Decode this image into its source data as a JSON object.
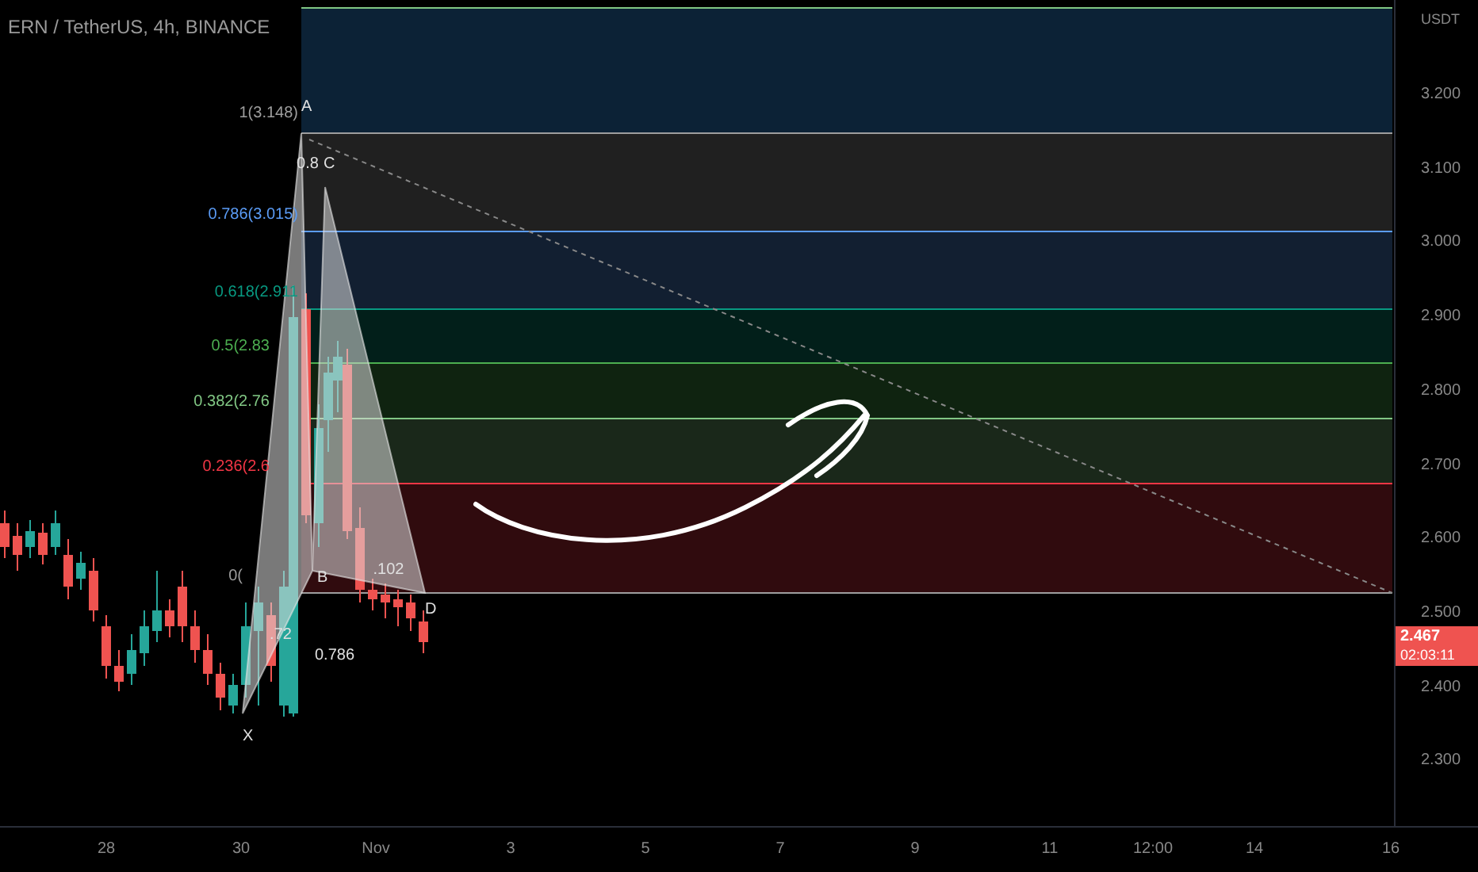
{
  "title": "ERN / TetherUS, 4h, BINANCE",
  "fib_levels": [
    {
      "label": "1(3.148)",
      "color": "#9e9e9e"
    },
    {
      "label": "0.786(3.015)",
      "color": "#5b9cf6"
    },
    {
      "label": "0.618(2.911",
      "color": "#089981"
    },
    {
      "label": "0.5(2.83",
      "color": "#4caf50"
    },
    {
      "label": "0.382(2.76",
      "color": "#81c784"
    },
    {
      "label": "0.236(2.6",
      "color": "#f23645"
    },
    {
      "label": "0(",
      "color": "#9e9e9e"
    }
  ],
  "pattern_points": [
    "X",
    "A",
    "B",
    "C",
    "D"
  ],
  "ratio_labels": [
    "0.8",
    ".72",
    ".102",
    "0.786"
  ],
  "price_axis": {
    "unit": "USDT",
    "ticks": [
      "3.200",
      "3.100",
      "3.000",
      "2.900",
      "2.800",
      "2.700",
      "2.600",
      "2.500",
      "2.400",
      "2.300"
    ]
  },
  "price_tag": {
    "price": "2.467",
    "countdown": "02:03:11"
  },
  "time_axis": [
    "28",
    "30",
    "Nov",
    "3",
    "5",
    "7",
    "9",
    "11",
    "12:00",
    "14",
    "16"
  ]
}
